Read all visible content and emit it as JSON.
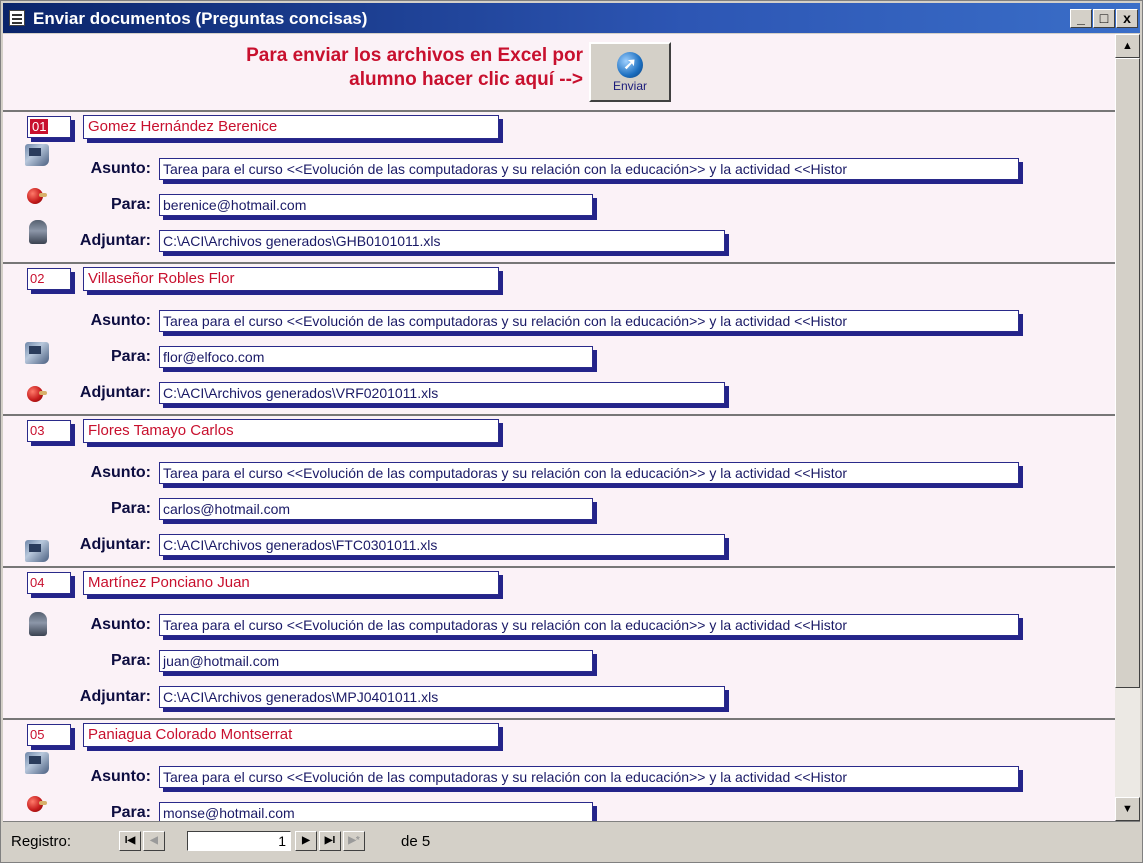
{
  "window": {
    "title": "Enviar documentos (Preguntas concisas)",
    "minimize": "_",
    "maximize": "□",
    "close": "x"
  },
  "header": {
    "instruction_line1": "Para enviar los archivos en Excel por",
    "instruction_line2": "alumno hacer clic aquí -->",
    "send_label": "Enviar"
  },
  "labels": {
    "asunto": "Asunto:",
    "para": "Para:",
    "adjuntar": "Adjuntar:"
  },
  "records": [
    {
      "num": "01",
      "name": "Gomez Hernández Berenice",
      "asunto": "Tarea para el curso <<Evolución de las computadoras y su relación con la educación>> y la actividad <<Histor",
      "para": "berenice@hotmail.com",
      "adjuntar": "C:\\ACI\\Archivos generados\\GHB0101011.xls"
    },
    {
      "num": "02",
      "name": "Villaseñor Robles Flor",
      "asunto": "Tarea para el curso <<Evolución de las computadoras y su relación con la educación>> y la actividad <<Histor",
      "para": "flor@elfoco.com",
      "adjuntar": "C:\\ACI\\Archivos generados\\VRF0201011.xls"
    },
    {
      "num": "03",
      "name": "Flores Tamayo Carlos",
      "asunto": "Tarea para el curso <<Evolución de las computadoras y su relación con la educación>> y la actividad <<Histor",
      "para": "carlos@hotmail.com",
      "adjuntar": "C:\\ACI\\Archivos generados\\FTC0301011.xls"
    },
    {
      "num": "04",
      "name": "Martínez Ponciano Juan",
      "asunto": "Tarea para el curso <<Evolución de las computadoras y su relación con la educación>> y la actividad <<Histor",
      "para": "juan@hotmail.com",
      "adjuntar": "C:\\ACI\\Archivos generados\\MPJ0401011.xls"
    },
    {
      "num": "05",
      "name": "Paniagua Colorado Montserrat",
      "asunto": "Tarea para el curso <<Evolución de las computadoras y su relación con la educación>> y la actividad <<Histor",
      "para": "monse@hotmail.com",
      "adjuntar": ""
    }
  ],
  "icons": [
    "computer-icon",
    "apple-icon",
    "figure-icon"
  ],
  "navigation": {
    "label": "Registro:",
    "current_record": "1",
    "of_label": "de 5",
    "first": "I◀",
    "prev": "◀",
    "next": "▶",
    "last": "▶I",
    "new": "▶*"
  },
  "colors": {
    "title_bar": "#0a246a",
    "accent_red": "#c8102e",
    "field_shadow": "#24248a",
    "form_bg": "#fbf2f7"
  }
}
